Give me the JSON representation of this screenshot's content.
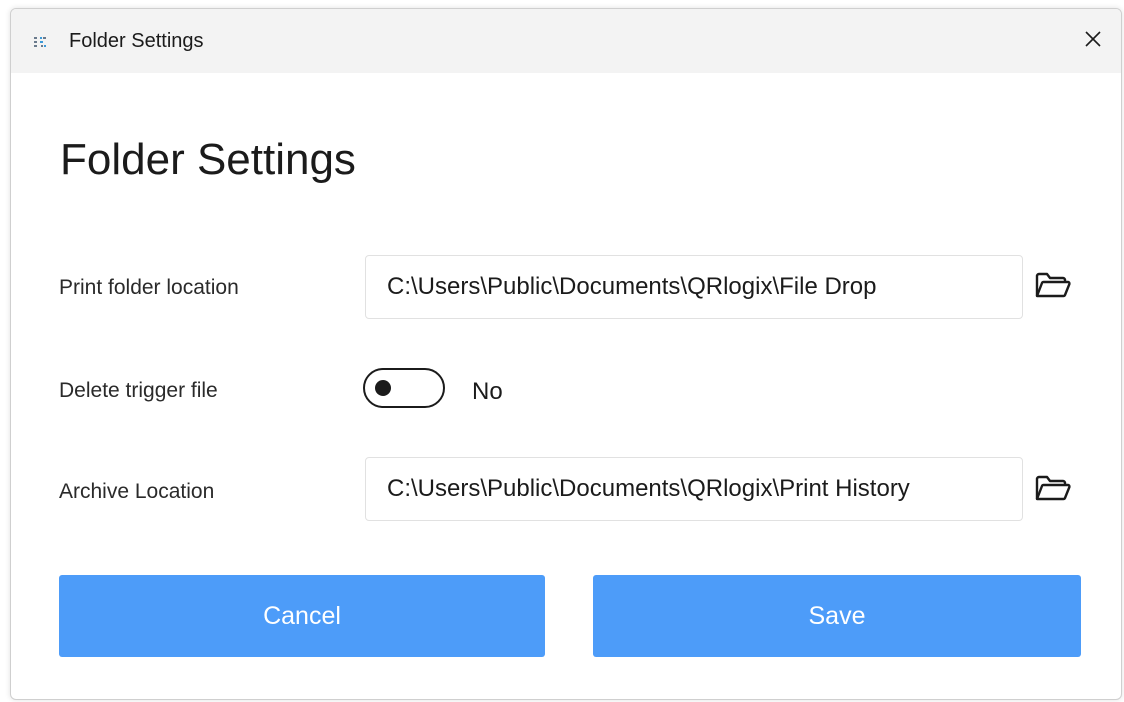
{
  "window": {
    "title": "Folder Settings",
    "app_icon": "app-logo-icon",
    "close_icon": "close-icon"
  },
  "dialog": {
    "heading": "Folder Settings"
  },
  "fields": {
    "print_folder": {
      "label": "Print folder location",
      "value": "C:\\Users\\Public\\Documents\\QRlogix\\File Drop",
      "icon": "folder-open-icon"
    },
    "delete_trigger": {
      "label": "Delete trigger file",
      "state_text": "No",
      "checked": false
    },
    "archive": {
      "label": "Archive Location",
      "value": "C:\\Users\\Public\\Documents\\QRlogix\\Print History",
      "icon": "folder-open-icon"
    }
  },
  "buttons": {
    "cancel_label": "Cancel",
    "save_label": "Save"
  },
  "colors": {
    "accent": "#4d9cf9",
    "titlebar": "#f3f3f3",
    "text": "#1b1b1b"
  }
}
